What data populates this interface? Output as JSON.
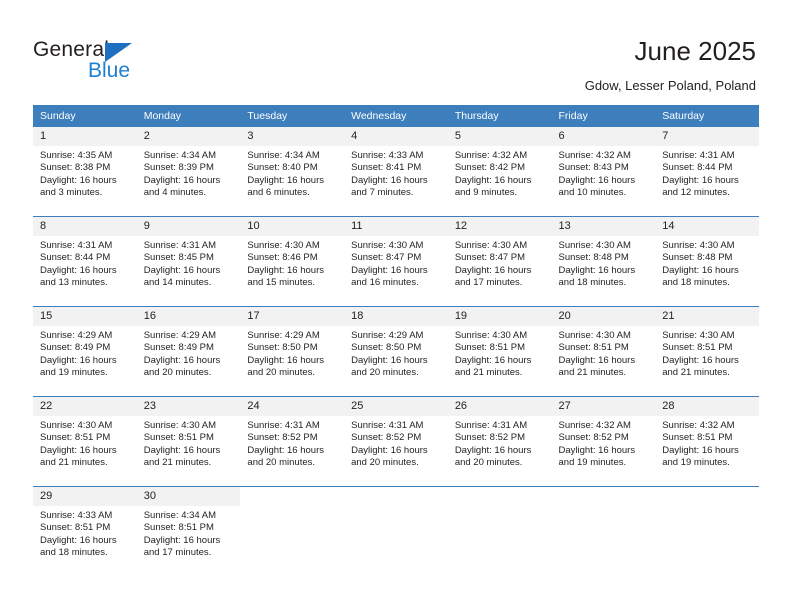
{
  "brand": {
    "name_top": "General",
    "name_bottom": "Blue",
    "triangle_color": "#1f6fc0",
    "blue_color": "#1f7fd0"
  },
  "header": {
    "title": "June 2025",
    "subtitle": "Gdow, Lesser Poland, Poland"
  },
  "theme": {
    "header_bg": "#3d7ebd",
    "daynum_bg": "#f2f2f2",
    "text_color": "#231f20",
    "page_bg": "#ffffff"
  },
  "calendar": {
    "weekday_headers": [
      "Sunday",
      "Monday",
      "Tuesday",
      "Wednesday",
      "Thursday",
      "Friday",
      "Saturday"
    ],
    "labels": {
      "sunrise": "Sunrise:",
      "sunset": "Sunset:",
      "daylight": "Daylight:"
    },
    "weeks": [
      [
        {
          "day": "1",
          "sunrise": "Sunrise: 4:35 AM",
          "sunset": "Sunset: 8:38 PM",
          "daylight": "Daylight: 16 hours and 3 minutes."
        },
        {
          "day": "2",
          "sunrise": "Sunrise: 4:34 AM",
          "sunset": "Sunset: 8:39 PM",
          "daylight": "Daylight: 16 hours and 4 minutes."
        },
        {
          "day": "3",
          "sunrise": "Sunrise: 4:34 AM",
          "sunset": "Sunset: 8:40 PM",
          "daylight": "Daylight: 16 hours and 6 minutes."
        },
        {
          "day": "4",
          "sunrise": "Sunrise: 4:33 AM",
          "sunset": "Sunset: 8:41 PM",
          "daylight": "Daylight: 16 hours and 7 minutes."
        },
        {
          "day": "5",
          "sunrise": "Sunrise: 4:32 AM",
          "sunset": "Sunset: 8:42 PM",
          "daylight": "Daylight: 16 hours and 9 minutes."
        },
        {
          "day": "6",
          "sunrise": "Sunrise: 4:32 AM",
          "sunset": "Sunset: 8:43 PM",
          "daylight": "Daylight: 16 hours and 10 minutes."
        },
        {
          "day": "7",
          "sunrise": "Sunrise: 4:31 AM",
          "sunset": "Sunset: 8:44 PM",
          "daylight": "Daylight: 16 hours and 12 minutes."
        }
      ],
      [
        {
          "day": "8",
          "sunrise": "Sunrise: 4:31 AM",
          "sunset": "Sunset: 8:44 PM",
          "daylight": "Daylight: 16 hours and 13 minutes."
        },
        {
          "day": "9",
          "sunrise": "Sunrise: 4:31 AM",
          "sunset": "Sunset: 8:45 PM",
          "daylight": "Daylight: 16 hours and 14 minutes."
        },
        {
          "day": "10",
          "sunrise": "Sunrise: 4:30 AM",
          "sunset": "Sunset: 8:46 PM",
          "daylight": "Daylight: 16 hours and 15 minutes."
        },
        {
          "day": "11",
          "sunrise": "Sunrise: 4:30 AM",
          "sunset": "Sunset: 8:47 PM",
          "daylight": "Daylight: 16 hours and 16 minutes."
        },
        {
          "day": "12",
          "sunrise": "Sunrise: 4:30 AM",
          "sunset": "Sunset: 8:47 PM",
          "daylight": "Daylight: 16 hours and 17 minutes."
        },
        {
          "day": "13",
          "sunrise": "Sunrise: 4:30 AM",
          "sunset": "Sunset: 8:48 PM",
          "daylight": "Daylight: 16 hours and 18 minutes."
        },
        {
          "day": "14",
          "sunrise": "Sunrise: 4:30 AM",
          "sunset": "Sunset: 8:48 PM",
          "daylight": "Daylight: 16 hours and 18 minutes."
        }
      ],
      [
        {
          "day": "15",
          "sunrise": "Sunrise: 4:29 AM",
          "sunset": "Sunset: 8:49 PM",
          "daylight": "Daylight: 16 hours and 19 minutes."
        },
        {
          "day": "16",
          "sunrise": "Sunrise: 4:29 AM",
          "sunset": "Sunset: 8:49 PM",
          "daylight": "Daylight: 16 hours and 20 minutes."
        },
        {
          "day": "17",
          "sunrise": "Sunrise: 4:29 AM",
          "sunset": "Sunset: 8:50 PM",
          "daylight": "Daylight: 16 hours and 20 minutes."
        },
        {
          "day": "18",
          "sunrise": "Sunrise: 4:29 AM",
          "sunset": "Sunset: 8:50 PM",
          "daylight": "Daylight: 16 hours and 20 minutes."
        },
        {
          "day": "19",
          "sunrise": "Sunrise: 4:30 AM",
          "sunset": "Sunset: 8:51 PM",
          "daylight": "Daylight: 16 hours and 21 minutes."
        },
        {
          "day": "20",
          "sunrise": "Sunrise: 4:30 AM",
          "sunset": "Sunset: 8:51 PM",
          "daylight": "Daylight: 16 hours and 21 minutes."
        },
        {
          "day": "21",
          "sunrise": "Sunrise: 4:30 AM",
          "sunset": "Sunset: 8:51 PM",
          "daylight": "Daylight: 16 hours and 21 minutes."
        }
      ],
      [
        {
          "day": "22",
          "sunrise": "Sunrise: 4:30 AM",
          "sunset": "Sunset: 8:51 PM",
          "daylight": "Daylight: 16 hours and 21 minutes."
        },
        {
          "day": "23",
          "sunrise": "Sunrise: 4:30 AM",
          "sunset": "Sunset: 8:51 PM",
          "daylight": "Daylight: 16 hours and 21 minutes."
        },
        {
          "day": "24",
          "sunrise": "Sunrise: 4:31 AM",
          "sunset": "Sunset: 8:52 PM",
          "daylight": "Daylight: 16 hours and 20 minutes."
        },
        {
          "day": "25",
          "sunrise": "Sunrise: 4:31 AM",
          "sunset": "Sunset: 8:52 PM",
          "daylight": "Daylight: 16 hours and 20 minutes."
        },
        {
          "day": "26",
          "sunrise": "Sunrise: 4:31 AM",
          "sunset": "Sunset: 8:52 PM",
          "daylight": "Daylight: 16 hours and 20 minutes."
        },
        {
          "day": "27",
          "sunrise": "Sunrise: 4:32 AM",
          "sunset": "Sunset: 8:52 PM",
          "daylight": "Daylight: 16 hours and 19 minutes."
        },
        {
          "day": "28",
          "sunrise": "Sunrise: 4:32 AM",
          "sunset": "Sunset: 8:51 PM",
          "daylight": "Daylight: 16 hours and 19 minutes."
        }
      ],
      [
        {
          "day": "29",
          "sunrise": "Sunrise: 4:33 AM",
          "sunset": "Sunset: 8:51 PM",
          "daylight": "Daylight: 16 hours and 18 minutes."
        },
        {
          "day": "30",
          "sunrise": "Sunrise: 4:34 AM",
          "sunset": "Sunset: 8:51 PM",
          "daylight": "Daylight: 16 hours and 17 minutes."
        },
        {
          "day": "",
          "sunrise": "",
          "sunset": "",
          "daylight": ""
        },
        {
          "day": "",
          "sunrise": "",
          "sunset": "",
          "daylight": ""
        },
        {
          "day": "",
          "sunrise": "",
          "sunset": "",
          "daylight": ""
        },
        {
          "day": "",
          "sunrise": "",
          "sunset": "",
          "daylight": ""
        },
        {
          "day": "",
          "sunrise": "",
          "sunset": "",
          "daylight": ""
        }
      ]
    ]
  }
}
